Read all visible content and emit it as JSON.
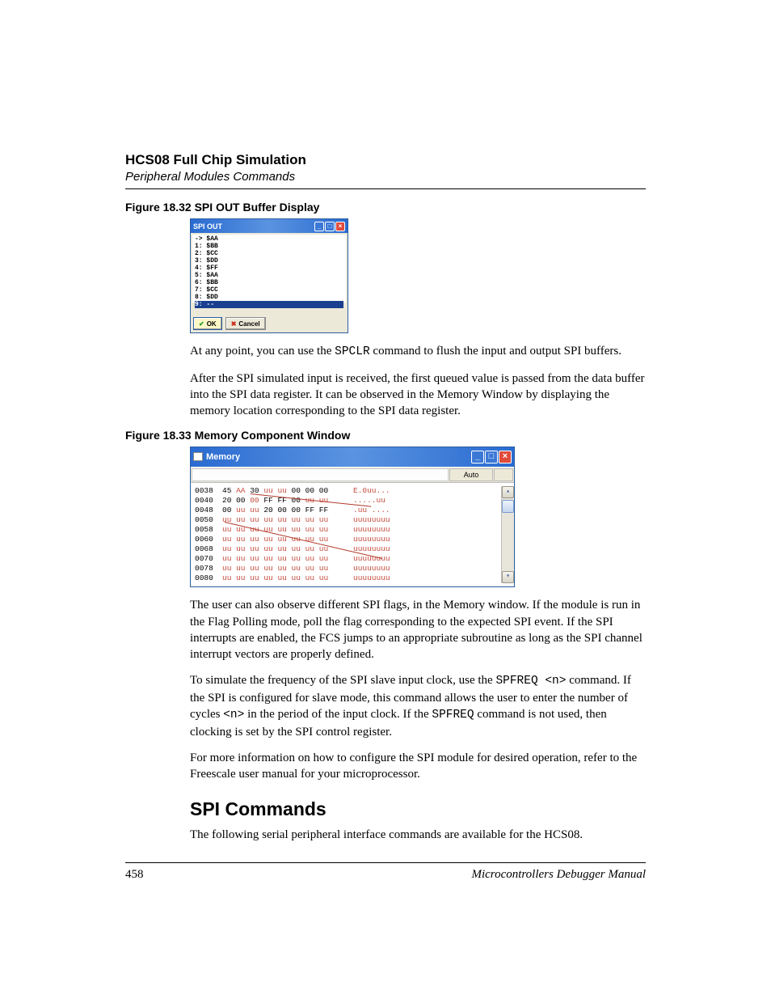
{
  "header": {
    "title": "HCS08 Full Chip Simulation",
    "subtitle": "Peripheral Modules Commands"
  },
  "fig1": {
    "caption": "Figure 18.32  SPI OUT Buffer Display"
  },
  "spi_window": {
    "title": "SPI OUT",
    "rows": [
      "-> $AA",
      "1: $BB",
      "2: $CC",
      "3: $DD",
      "4: $FF",
      "5: $AA",
      "6: $BB",
      "7: $CC",
      "8: $DD"
    ],
    "selected_row": "9: --",
    "ok_label": "OK",
    "cancel_label": "Cancel"
  },
  "para1_a": "At any point, you can use the ",
  "para1_code": "SPCLR",
  "para1_b": " command to flush the input and output SPI buffers.",
  "para2": "After the SPI simulated input is received, the first queued value is passed from the data buffer into the SPI data register. It can be observed in the Memory Window by displaying the memory location corresponding to the SPI data register.",
  "fig2": {
    "caption": "Figure 18.33  Memory Component Window"
  },
  "mem_window": {
    "title": "Memory",
    "auto_label": "Auto",
    "rows": [
      {
        "addr": "0038",
        "bytes": [
          [
            "45",
            "nm"
          ],
          [
            "AA",
            "rd"
          ],
          [
            "30",
            "nm"
          ],
          [
            "uu",
            "rd"
          ],
          [
            "uu",
            "rd"
          ],
          [
            "00",
            "nm"
          ],
          [
            "00",
            "nm"
          ],
          [
            "00",
            "nm"
          ]
        ],
        "ascii": "E.0uu..."
      },
      {
        "addr": "0040",
        "bytes": [
          [
            "20",
            "nm"
          ],
          [
            "00",
            "nm"
          ],
          [
            "00",
            "rd"
          ],
          [
            "FF",
            "nm"
          ],
          [
            "FF",
            "nm"
          ],
          [
            "00",
            "nm"
          ],
          [
            "uu",
            "rd"
          ],
          [
            "uu",
            "rd"
          ]
        ],
        "ascii": ".....uu"
      },
      {
        "addr": "0048",
        "bytes": [
          [
            "00",
            "nm"
          ],
          [
            "uu",
            "rd"
          ],
          [
            "uu",
            "rd"
          ],
          [
            "20",
            "nm"
          ],
          [
            "00",
            "nm"
          ],
          [
            "00",
            "nm"
          ],
          [
            "FF",
            "nm"
          ],
          [
            "FF",
            "nm"
          ]
        ],
        "ascii": ".uu ...."
      },
      {
        "addr": "0050",
        "bytes": [
          [
            "uu",
            "rd"
          ],
          [
            "uu",
            "rd"
          ],
          [
            "uu",
            "rd"
          ],
          [
            "uu",
            "rd"
          ],
          [
            "uu",
            "rd"
          ],
          [
            "uu",
            "rd"
          ],
          [
            "uu",
            "rd"
          ],
          [
            "uu",
            "rd"
          ]
        ],
        "ascii": "uuuuuuuu"
      },
      {
        "addr": "0058",
        "bytes": [
          [
            "uu",
            "rd"
          ],
          [
            "uu",
            "rd"
          ],
          [
            "uu",
            "rd"
          ],
          [
            "uu",
            "rd"
          ],
          [
            "uu",
            "rd"
          ],
          [
            "uu",
            "rd"
          ],
          [
            "uu",
            "rd"
          ],
          [
            "uu",
            "rd"
          ]
        ],
        "ascii": "uuuuuuuu"
      },
      {
        "addr": "0060",
        "bytes": [
          [
            "uu",
            "rd"
          ],
          [
            "uu",
            "rd"
          ],
          [
            "uu",
            "rd"
          ],
          [
            "uu",
            "rd"
          ],
          [
            "uu",
            "rd"
          ],
          [
            "uu",
            "rd"
          ],
          [
            "uu",
            "rd"
          ],
          [
            "uu",
            "rd"
          ]
        ],
        "ascii": "uuuuuuuu"
      },
      {
        "addr": "0068",
        "bytes": [
          [
            "uu",
            "rd"
          ],
          [
            "uu",
            "rd"
          ],
          [
            "uu",
            "rd"
          ],
          [
            "uu",
            "rd"
          ],
          [
            "uu",
            "rd"
          ],
          [
            "uu",
            "rd"
          ],
          [
            "uu",
            "rd"
          ],
          [
            "uu",
            "rd"
          ]
        ],
        "ascii": "uuuuuuuu"
      },
      {
        "addr": "0070",
        "bytes": [
          [
            "uu",
            "rd"
          ],
          [
            "uu",
            "rd"
          ],
          [
            "uu",
            "rd"
          ],
          [
            "uu",
            "rd"
          ],
          [
            "uu",
            "rd"
          ],
          [
            "uu",
            "rd"
          ],
          [
            "uu",
            "rd"
          ],
          [
            "uu",
            "rd"
          ]
        ],
        "ascii": "uuuuuuuu"
      },
      {
        "addr": "0078",
        "bytes": [
          [
            "uu",
            "rd"
          ],
          [
            "uu",
            "rd"
          ],
          [
            "uu",
            "rd"
          ],
          [
            "uu",
            "rd"
          ],
          [
            "uu",
            "rd"
          ],
          [
            "uu",
            "rd"
          ],
          [
            "uu",
            "rd"
          ],
          [
            "uu",
            "rd"
          ]
        ],
        "ascii": "uuuuuuuu"
      },
      {
        "addr": "0080",
        "bytes": [
          [
            "uu",
            "rd"
          ],
          [
            "uu",
            "rd"
          ],
          [
            "uu",
            "rd"
          ],
          [
            "uu",
            "rd"
          ],
          [
            "uu",
            "rd"
          ],
          [
            "uu",
            "rd"
          ],
          [
            "uu",
            "rd"
          ],
          [
            "uu",
            "rd"
          ]
        ],
        "ascii": "uuuuuuuu"
      }
    ]
  },
  "para3": "The user can also observe different SPI flags, in the Memory window. If the module is run in the Flag Polling mode, poll the flag corresponding to the expected SPI event. If the SPI interrupts are enabled, the FCS jumps to an appropriate subroutine as long as the SPI channel interrupt vectors are properly defined.",
  "para4_a": "To simulate the frequency of the SPI slave input clock, use the ",
  "para4_code1": "SPFREQ <n>",
  "para4_b": " command. If the SPI is configured for slave mode, this command allows the user to enter the number of cycles ",
  "para4_code2": "<n>",
  "para4_c": " in the period of the input clock. If the ",
  "para4_code3": "SPFREQ",
  "para4_d": " command is not used, then clocking is set by the SPI control register.",
  "para5": "For more information on how to configure the SPI module for desired operation, refer to the Freescale user manual for your microprocessor.",
  "h2": "SPI Commands",
  "para6": "The following serial peripheral interface commands are available for the HCS08.",
  "footer": {
    "page": "458",
    "book": "Microcontrollers Debugger Manual"
  }
}
